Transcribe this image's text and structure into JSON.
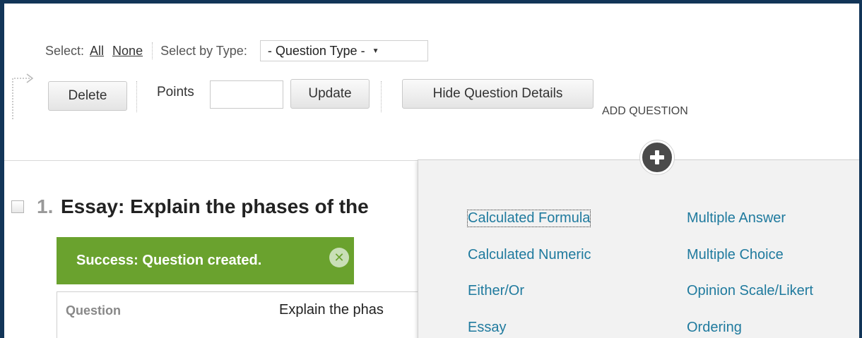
{
  "toolbar": {
    "select_label": "Select:",
    "all_link": "All",
    "none_link": "None",
    "select_by_type_label": "Select by Type:",
    "question_type_value": "- Question Type -",
    "delete_button": "Delete",
    "points_label": "Points",
    "points_value": "",
    "update_button": "Update",
    "hide_details_button": "Hide Question Details",
    "add_question_label": "ADD QUESTION"
  },
  "question": {
    "number": "1.",
    "title": "Essay: Explain the phases of the",
    "success_message": "Success: Question created.",
    "column_label": "Question",
    "question_text": "Explain the phas"
  },
  "add_menu": {
    "left_options": [
      "Calculated Formula",
      "Calculated Numeric",
      "Either/Or",
      "Essay"
    ],
    "right_options": [
      "Multiple Answer",
      "Multiple Choice",
      "Opinion Scale/Likert",
      "Ordering"
    ]
  },
  "colors": {
    "frame_border": "#123558",
    "success_green": "#6aa22e",
    "link_teal": "#1f7a9e",
    "popup_bg": "#f2f2f2"
  },
  "icons": [
    "dropdown-caret-icon",
    "close-circle-icon",
    "plus-circle-icon",
    "corner-arrow-icon"
  ]
}
